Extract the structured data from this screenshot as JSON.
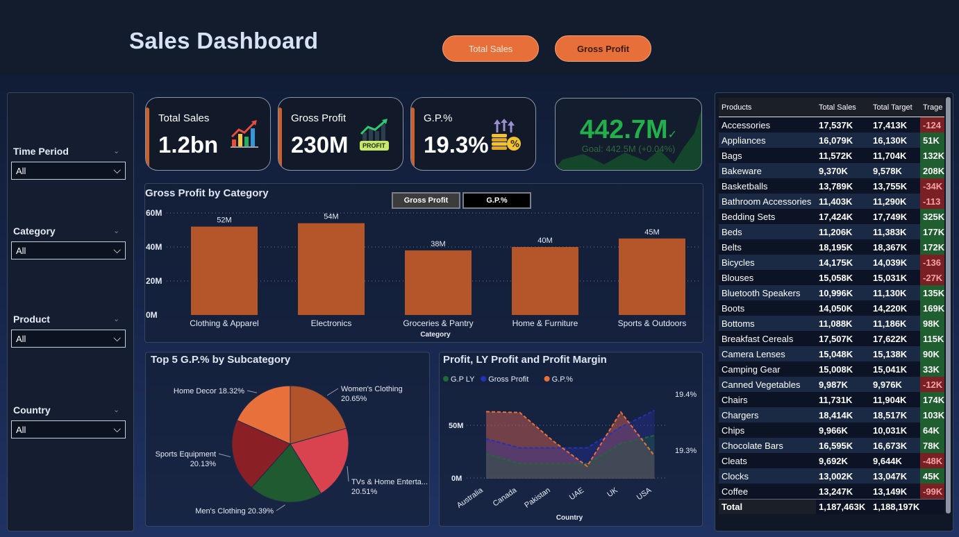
{
  "header": {
    "title": "Sales Dashboard",
    "buttons": {
      "total_sales": "Total Sales",
      "gross_profit": "Gross Profit"
    }
  },
  "slicers": [
    {
      "label": "Time Period",
      "value": "All"
    },
    {
      "label": "Category",
      "value": "All"
    },
    {
      "label": "Product",
      "value": "All"
    },
    {
      "label": "Country",
      "value": "All"
    }
  ],
  "kpis": {
    "total_sales": {
      "label": "Total Sales",
      "value": "1.2bn"
    },
    "gross_profit": {
      "label": "Gross Profit",
      "value": "230M",
      "icon_text": "PROFIT"
    },
    "gp_pct": {
      "label": "G.P.%",
      "value": "19.3%"
    },
    "goal": {
      "value": "442.7M",
      "goal_text": "Goal: 442.5M (+0.04%)"
    }
  },
  "colors": {
    "accent": "#e7703a",
    "bar": "#b5552a",
    "positive": "#22b04a",
    "negative": "#7a1f24"
  },
  "bar_toggles": {
    "active": "Gross Profit",
    "inactive": "G.P.%"
  },
  "table": {
    "headers": [
      "Products",
      "Total Sales",
      "Total Target",
      "Trage"
    ],
    "rows": [
      [
        "Accessories",
        "17,537K",
        "17,413K",
        "-124",
        "neg"
      ],
      [
        "Appliances",
        "16,079K",
        "16,130K",
        "51K",
        "pos"
      ],
      [
        "Bags",
        "11,572K",
        "11,704K",
        "132K",
        "pos"
      ],
      [
        "Bakeware",
        "9,370K",
        "9,578K",
        "208K",
        "pos"
      ],
      [
        "Basketballs",
        "13,789K",
        "13,755K",
        "-34K",
        "neg"
      ],
      [
        "Bathroom Accessories",
        "11,403K",
        "11,290K",
        "-113",
        "neg"
      ],
      [
        "Bedding Sets",
        "17,424K",
        "17,749K",
        "325K",
        "pos"
      ],
      [
        "Beds",
        "11,206K",
        "11,383K",
        "177K",
        "pos"
      ],
      [
        "Belts",
        "18,195K",
        "18,367K",
        "172K",
        "pos"
      ],
      [
        "Bicycles",
        "14,175K",
        "14,039K",
        "-136",
        "neg"
      ],
      [
        "Blouses",
        "15,058K",
        "15,031K",
        "-27K",
        "neg"
      ],
      [
        "Bluetooth Speakers",
        "10,996K",
        "11,130K",
        "135K",
        "pos"
      ],
      [
        "Boots",
        "14,050K",
        "14,220K",
        "169K",
        "pos"
      ],
      [
        "Bottoms",
        "11,088K",
        "11,186K",
        "98K",
        "pos"
      ],
      [
        "Breakfast Cereals",
        "17,507K",
        "17,622K",
        "115K",
        "pos"
      ],
      [
        "Camera Lenses",
        "15,048K",
        "15,138K",
        "90K",
        "pos"
      ],
      [
        "Camping Gear",
        "15,008K",
        "15,041K",
        "33K",
        "pos"
      ],
      [
        "Canned Vegetables",
        "9,987K",
        "9,976K",
        "-12K",
        "neg"
      ],
      [
        "Chairs",
        "11,731K",
        "11,904K",
        "174K",
        "pos"
      ],
      [
        "Chargers",
        "18,414K",
        "18,517K",
        "103K",
        "pos"
      ],
      [
        "Chips",
        "9,966K",
        "10,031K",
        "64K",
        "pos"
      ],
      [
        "Chocolate Bars",
        "16,595K",
        "16,673K",
        "78K",
        "pos"
      ],
      [
        "Cleats",
        "9,692K",
        "9,644K",
        "-48K",
        "neg"
      ],
      [
        "Clocks",
        "13,002K",
        "13,047K",
        "45K",
        "pos"
      ],
      [
        "Coffee",
        "13,247K",
        "13,149K",
        "-99K",
        "neg"
      ]
    ],
    "total": [
      "Total",
      "1,187,463K",
      "1,188,197K",
      ""
    ]
  },
  "chart_data": [
    {
      "type": "bar",
      "title": "Gross Profit by Category",
      "xlabel": "Category",
      "ylabel": "",
      "categories": [
        "Clothing & Apparel",
        "Electronics",
        "Groceries & Pantry",
        "Home & Furniture",
        "Sports & Outdoors"
      ],
      "values": [
        52,
        54,
        38,
        40,
        45
      ],
      "data_labels": [
        "52M",
        "54M",
        "38M",
        "40M",
        "45M"
      ],
      "yticks": [
        "0M",
        "20M",
        "40M",
        "60M"
      ],
      "ylim": [
        0,
        60
      ],
      "grid": true
    },
    {
      "type": "pie",
      "title": "Top 5 G.P.% by Subcategory",
      "slices": [
        {
          "label": "Women's Clothing",
          "pct": "20.65%",
          "value": 20.65,
          "color": "#b3532c"
        },
        {
          "label": "TVs & Home Enterta...",
          "pct": "20.51%",
          "value": 20.51,
          "color": "#d9434f"
        },
        {
          "label": "Men's Clothing",
          "pct": "20.39%",
          "value": 20.39,
          "color": "#1f5a30"
        },
        {
          "label": "Sports Equipment",
          "pct": "20.13%",
          "value": 20.13,
          "color": "#8a1f26"
        },
        {
          "label": "Home Decor",
          "pct": "18.32%",
          "value": 18.32,
          "color": "#e8703a"
        }
      ]
    },
    {
      "type": "area",
      "title": "Profit, LY Profit and Profit Margin",
      "xlabel": "Country",
      "categories": [
        "Australia",
        "Canada",
        "Pakistan",
        "UAE",
        "UK",
        "USA"
      ],
      "legend": [
        "G.P LY",
        "Gross Profit",
        "G.P.%"
      ],
      "legend_colors": [
        "#1f6a35",
        "#2432b8",
        "#e8703a"
      ],
      "series": [
        {
          "name": "G.P LY",
          "values": [
            30,
            18,
            18,
            18,
            42,
            52
          ]
        },
        {
          "name": "Gross Profit",
          "values": [
            48,
            37,
            37,
            37,
            62,
            82
          ]
        },
        {
          "name": "G.P.%",
          "values": [
            19.416,
            19.414,
            19.345,
            19.285,
            19.415,
            19.31
          ]
        }
      ],
      "left_axis": [
        "0M",
        "50M"
      ],
      "left_ylim": [
        0,
        100
      ],
      "right_axis": [
        "19.3%",
        "19.4%"
      ],
      "right_ylim": [
        19.255,
        19.455
      ]
    }
  ]
}
